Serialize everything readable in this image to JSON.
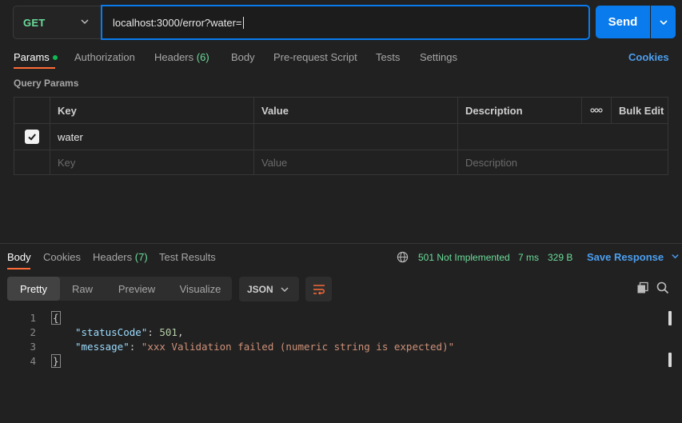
{
  "request": {
    "method": "GET",
    "url": "localhost:3000/error?water=",
    "send_label": "Send"
  },
  "request_tabs": {
    "params": "Params",
    "authorization": "Authorization",
    "headers": "Headers",
    "headers_count": "(6)",
    "body": "Body",
    "pre_request": "Pre-request Script",
    "tests": "Tests",
    "settings": "Settings",
    "cookies": "Cookies"
  },
  "query_params": {
    "title": "Query Params",
    "columns": {
      "key": "Key",
      "value": "Value",
      "description": "Description",
      "bulk_edit": "Bulk Edit"
    },
    "rows": [
      {
        "checked": true,
        "key": "water",
        "value": "",
        "description": ""
      }
    ],
    "placeholders": {
      "key": "Key",
      "value": "Value",
      "description": "Description"
    }
  },
  "response_tabs": {
    "body": "Body",
    "cookies": "Cookies",
    "headers": "Headers",
    "headers_count": "(7)",
    "test_results": "Test Results"
  },
  "response_status": {
    "status": "501 Not Implemented",
    "time": "7 ms",
    "size": "329 B",
    "save_response": "Save Response"
  },
  "response_view": {
    "modes": [
      "Pretty",
      "Raw",
      "Preview",
      "Visualize"
    ],
    "active_mode": "Pretty",
    "format": "JSON"
  },
  "response_body": {
    "line_numbers": [
      "1",
      "2",
      "3",
      "4"
    ],
    "open_brace": "{",
    "close_brace": "}",
    "lines": [
      {
        "key": "\"statusCode\"",
        "sep": ": ",
        "value": "501",
        "trail": ","
      },
      {
        "key": "\"message\"",
        "sep": ": ",
        "value": "\"xxx Validation failed (numeric string is expected)\"",
        "trail": ""
      }
    ]
  },
  "colors": {
    "accent_blue": "#097bed",
    "active_tab_underline": "#ff6c37",
    "status_green": "#6bdd9a"
  }
}
